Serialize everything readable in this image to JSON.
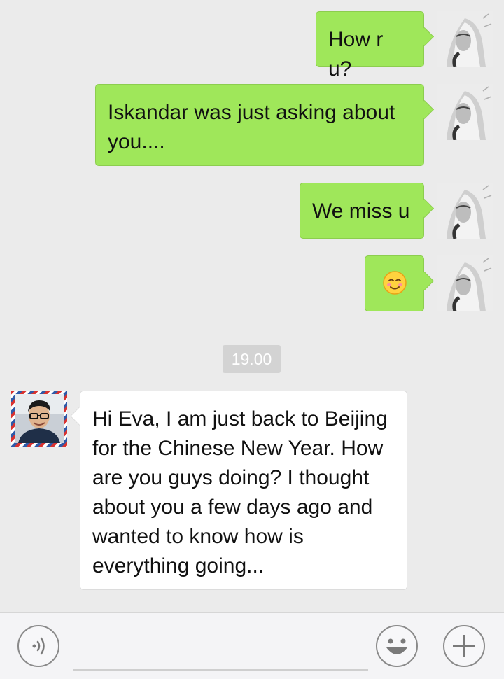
{
  "chat": {
    "outgoing": [
      {
        "text": "How r u?"
      },
      {
        "text": "Iskandar was just asking about you...."
      },
      {
        "text": "We miss u"
      },
      {
        "emoji": "smiling-blush-emoji"
      }
    ],
    "timestamp": "19.00",
    "incoming": [
      {
        "text": "Hi Eva, I am just back to Beijing for the Chinese New Year. How are you guys doing? I thought about you a few days ago and wanted to know how is everything going..."
      }
    ]
  },
  "input_bar": {
    "voice_icon": "voice-icon",
    "message_placeholder": "",
    "emoji_icon": "emoji-icon",
    "more_icon": "plus-icon"
  },
  "colors": {
    "background": "#ebebeb",
    "outgoing_bubble": "#9fe75a",
    "incoming_bubble": "#ffffff",
    "timestamp_bg": "#d3d3d3"
  }
}
